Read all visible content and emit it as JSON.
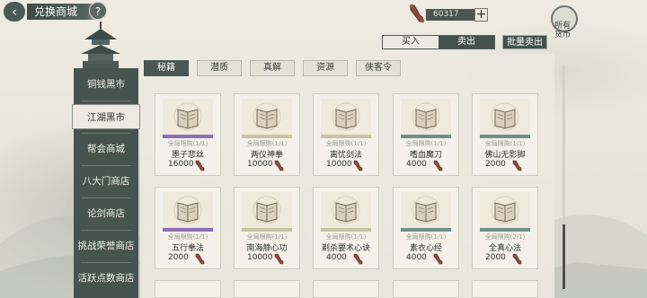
{
  "header": {
    "back_icon": "back-arrow-icon",
    "title": "兑换商城",
    "help_label": "?"
  },
  "currency": {
    "icon": "bone-currency-icon",
    "amount": "60317",
    "add_label": "+"
  },
  "emblem": {
    "text": "所有货币"
  },
  "trade": {
    "buy_label": "买入",
    "sell_label": "卖出",
    "bulk_sell_label": "批量卖出",
    "active": "sell"
  },
  "sidebar": {
    "items": [
      {
        "label": "铜钱黑市"
      },
      {
        "label": "江湖黑市"
      },
      {
        "label": "帮会商城"
      },
      {
        "label": "八大门商店"
      },
      {
        "label": "论剑商店"
      },
      {
        "label": "挑战荣誉商店"
      },
      {
        "label": "活跃点数商店"
      }
    ],
    "active_index": 1
  },
  "tabs": [
    {
      "label": "秘籍"
    },
    {
      "label": "潜质"
    },
    {
      "label": "真解"
    },
    {
      "label": "资源"
    },
    {
      "label": "侠客令"
    }
  ],
  "active_tab": 0,
  "items": [
    {
      "limit": "全局限购(1/1)",
      "name": "墨子悲丝",
      "price": "16000",
      "rarity_color": "#8b6fb8"
    },
    {
      "limit": "全局限购(1/1)",
      "name": "两仪神拳",
      "price": "10000",
      "rarity_color": "#c9c2a4"
    },
    {
      "limit": "全局限购(1/1)",
      "name": "离忧剑法",
      "price": "10000",
      "rarity_color": "#c9c2a4"
    },
    {
      "limit": "全局限购(1/1)",
      "name": "嗜血魔刀",
      "price": "4000",
      "rarity_color": "#6f8f8a"
    },
    {
      "limit": "全局限购(1/1)",
      "name": "佛山无影脚",
      "price": "2000",
      "rarity_color": "#6f8f8a"
    },
    {
      "limit": "全局限购(1/1)",
      "name": "五行拳法",
      "price": "2000",
      "rarity_color": "#8b6fb8"
    },
    {
      "limit": "全局限购(1/1)",
      "name": "南海静心功",
      "price": "10000",
      "rarity_color": "#c9c2a4"
    },
    {
      "limit": "全局限购(1/1)",
      "name": "剃杀要术心诀",
      "price": "4000",
      "rarity_color": "#c9c2a4"
    },
    {
      "limit": "全局限购(1/1)",
      "name": "素衣心经",
      "price": "4000",
      "rarity_color": "#6f8f8a"
    },
    {
      "limit": "全局限购(2/1)",
      "name": "全真心法",
      "price": "2000",
      "rarity_color": "#6f8f8a"
    }
  ],
  "scroll": {
    "position": 0.72
  },
  "colors": {
    "sidebar_bg": "#465450",
    "accent_dark": "#44524e",
    "panel_bg": "#ece9e0"
  }
}
